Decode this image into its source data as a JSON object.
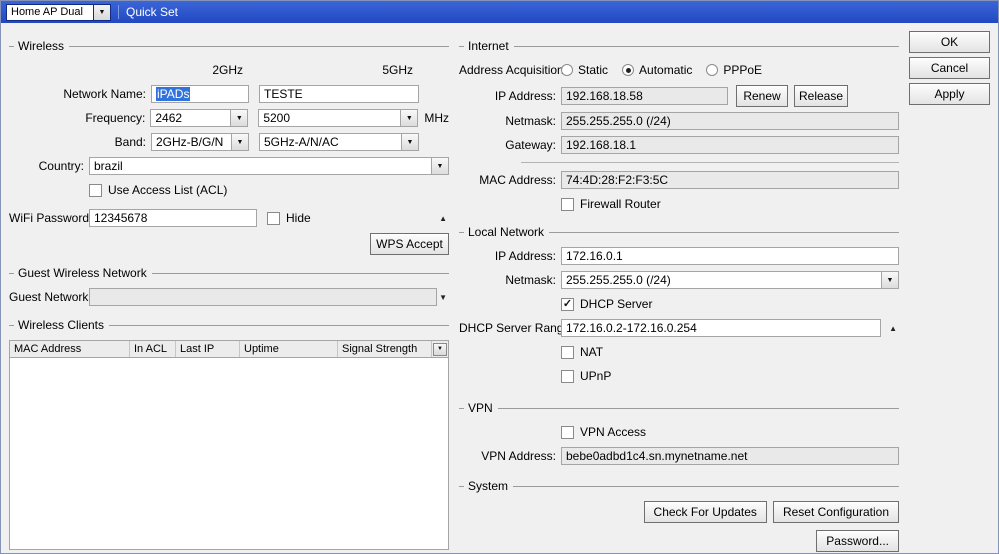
{
  "colors": {
    "titlebar_blue": "#2b53cf",
    "selection_blue": "#3173dd"
  },
  "titlebar": {
    "router_select": "Home AP Dual",
    "title": "Quick Set"
  },
  "actions": {
    "ok": "OK",
    "cancel": "Cancel",
    "apply": "Apply"
  },
  "wireless": {
    "group_label": "Wireless",
    "col_2ghz": "2GHz",
    "col_5ghz": "5GHz",
    "network_name_label": "Network Name:",
    "network_name_2ghz": "iPADs",
    "network_name_5ghz": "TESTE",
    "frequency_label": "Frequency:",
    "frequency_2ghz": "2462",
    "frequency_5ghz": "5200",
    "mhz_unit": "MHz",
    "band_label": "Band:",
    "band_2ghz": "2GHz-B/G/N",
    "band_5ghz": "5GHz-A/N/AC",
    "country_label": "Country:",
    "country": "brazil",
    "acl_label": "Use Access List (ACL)",
    "wifi_password_label": "WiFi Password:",
    "wifi_password": "12345678",
    "hide_label": "Hide",
    "wps_button": "WPS Accept"
  },
  "guest": {
    "group_label": "Guest Wireless Network",
    "guest_network_label": "Guest Network:",
    "guest_network_value": ""
  },
  "clients": {
    "group_label": "Wireless Clients",
    "columns": [
      "MAC Address",
      "In ACL",
      "Last IP",
      "Uptime",
      "Signal Strength"
    ],
    "rows": []
  },
  "internet": {
    "group_label": "Internet",
    "address_acquisition_label": "Address Acquisition:",
    "options": [
      "Static",
      "Automatic",
      "PPPoE"
    ],
    "selected_option": "Automatic",
    "ip_label": "IP Address:",
    "ip_value": "192.168.18.58",
    "renew_button": "Renew",
    "release_button": "Release",
    "netmask_label": "Netmask:",
    "netmask_value": "255.255.255.0 (/24)",
    "gateway_label": "Gateway:",
    "gateway_value": "192.168.18.1",
    "mac_label": "MAC Address:",
    "mac_value": "74:4D:28:F2:F3:5C",
    "firewall_label": "Firewall Router"
  },
  "local_network": {
    "group_label": "Local Network",
    "ip_label": "IP Address:",
    "ip_value": "172.16.0.1",
    "netmask_label": "Netmask:",
    "netmask_value": "255.255.255.0 (/24)",
    "dhcp_server_label": "DHCP Server",
    "dhcp_range_label": "DHCP Server Range:",
    "dhcp_range_value": "172.16.0.2-172.16.0.254",
    "nat_label": "NAT",
    "upnp_label": "UPnP"
  },
  "vpn": {
    "group_label": "VPN",
    "vpn_access_label": "VPN Access",
    "vpn_address_label": "VPN Address:",
    "vpn_address_value": "bebe0adbd1c4.sn.mynetname.net"
  },
  "system": {
    "group_label": "System",
    "check_updates_button": "Check For Updates",
    "reset_config_button": "Reset Configuration",
    "password_button": "Password..."
  }
}
